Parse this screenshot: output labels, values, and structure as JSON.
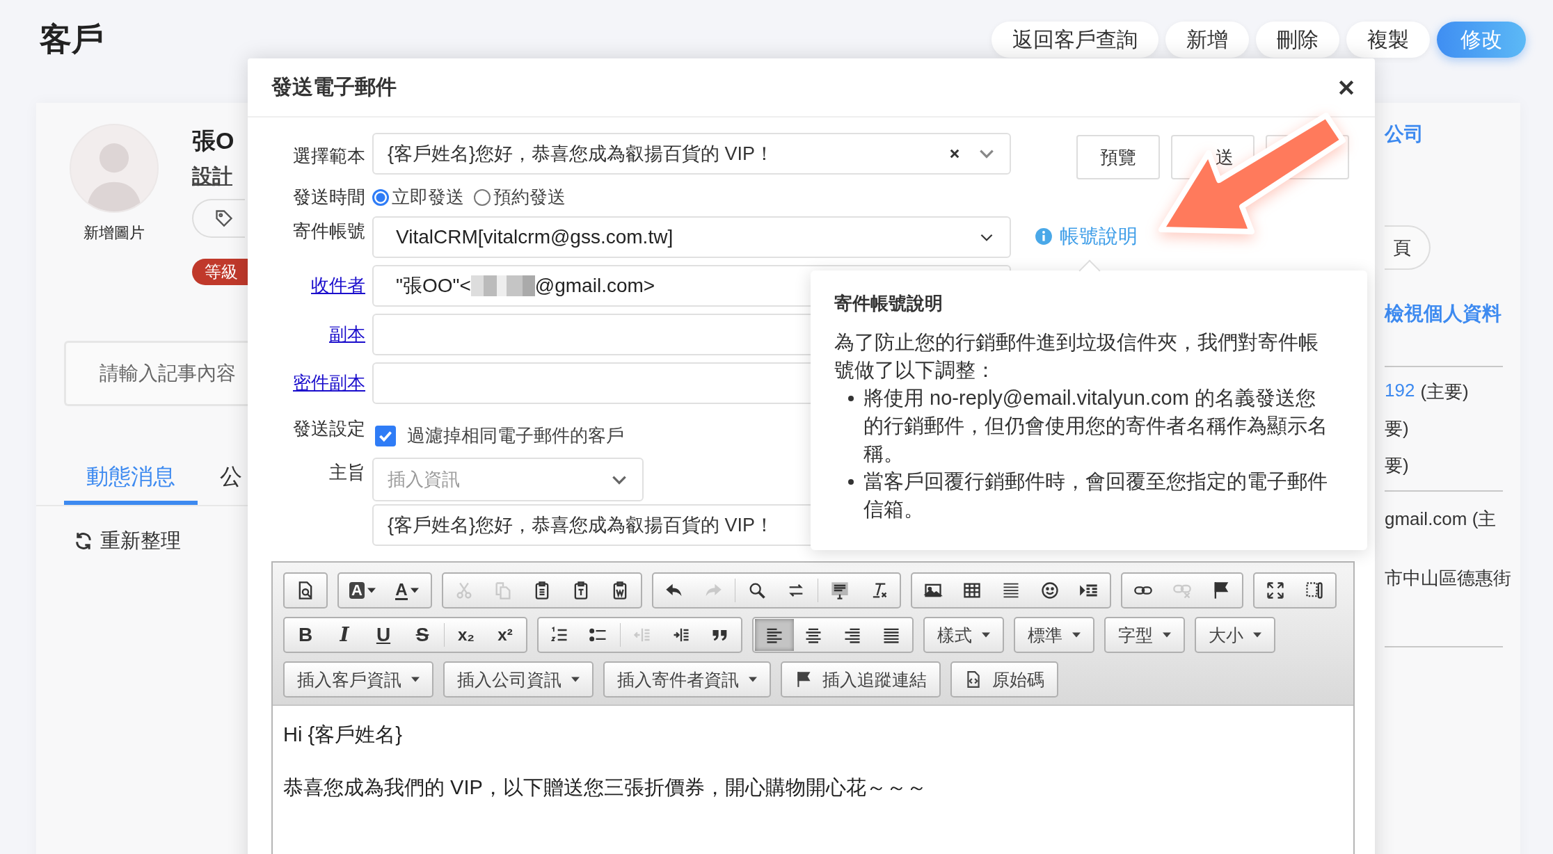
{
  "page": {
    "title": "客戶"
  },
  "top_buttons": [
    {
      "label": "返回客戶查詢",
      "kind": "default"
    },
    {
      "label": "新增",
      "kind": "default"
    },
    {
      "label": "刪除",
      "kind": "default"
    },
    {
      "label": "複製",
      "kind": "default"
    },
    {
      "label": "修改",
      "kind": "primary"
    }
  ],
  "customer": {
    "add_photo": "新增圖片",
    "name": "張O",
    "title": "設計",
    "badge": "等級",
    "note": {
      "placeholder": "請輸入記事內容"
    },
    "tabs": [
      {
        "label": "動態消息",
        "selected": true
      },
      {
        "label": "公",
        "selected": false
      }
    ],
    "refresh": "重新整理"
  },
  "side": {
    "company": "公司",
    "button": "頁",
    "profile_link": "檢視個人資料",
    "phone": {
      "number": "192",
      "note": "(主要)"
    },
    "lines": [
      "要)",
      "要)"
    ],
    "email": "gmail.com (主",
    "address": "市中山區德惠街"
  },
  "dialog": {
    "title": "發送電子郵件",
    "buttons": [
      "預覽",
      "送"
    ],
    "template": {
      "label": "選擇範本",
      "value": "{客戶姓名}您好，恭喜您成為叡揚百貨的 VIP！"
    },
    "send_time": {
      "label": "發送時間",
      "options": [
        {
          "label": "立即發送",
          "selected": true
        },
        {
          "label": "預約發送",
          "selected": false
        }
      ]
    },
    "account": {
      "label": "寄件帳號",
      "value": "VitalCRM[vitalcrm@gss.com.tw]",
      "help_link": "帳號說明"
    },
    "recipient": {
      "label": "收件者",
      "value_parts": [
        "\"張OO\"<",
        "@gmail.com>"
      ]
    },
    "cc": {
      "label": "副本"
    },
    "bcc": {
      "label": "密件副本"
    },
    "settings": {
      "label": "發送設定",
      "option": {
        "label": "過濾掉相同電子郵件的客戶",
        "checked": true
      }
    },
    "subject": {
      "label": "主旨",
      "insert": {
        "placeholder": "插入資訊"
      },
      "value": "{客戶姓名}您好，恭喜您成為叡揚百貨的 VIP！"
    },
    "tooltip": {
      "title": "寄件帳號說明",
      "intro": "為了防止您的行銷郵件進到垃圾信件夾，我們對寄件帳號做了以下調整：",
      "bullets": [
        "將使用 no-reply@email.vitalyun.com 的名義發送您的行銷郵件，但仍會使用您的寄件者名稱作為顯示名稱。",
        "當客戶回覆行銷郵件時，會回覆至您指定的電子郵件信箱。"
      ]
    },
    "editor": {
      "toolbar": {
        "rows": [
          {
            "groups": [
              {
                "items": [
                  {
                    "kind": "preview",
                    "disabled": false
                  }
                ]
              },
              {
                "items": [
                  {
                    "kind": "text-background",
                    "glyph": "A",
                    "disabled": false
                  },
                  {
                    "kind": "text-color",
                    "glyph": "A",
                    "disabled": false
                  }
                ]
              },
              {
                "items": [
                  {
                    "kind": "cut",
                    "disabled": true
                  },
                  {
                    "kind": "copy",
                    "disabled": true
                  },
                  {
                    "kind": "paste",
                    "disabled": false
                  },
                  {
                    "kind": "paste-text",
                    "disabled": false
                  },
                  {
                    "kind": "paste-word",
                    "disabled": false
                  }
                ]
              },
              {
                "items": [
                  {
                    "kind": "undo",
                    "disabled": false
                  },
                  {
                    "kind": "redo",
                    "disabled": true
                  },
                  {
                    "kind": "separator"
                  },
                  {
                    "kind": "find",
                    "disabled": false
                  },
                  {
                    "kind": "replace",
                    "disabled": false
                  },
                  {
                    "kind": "separator"
                  },
                  {
                    "kind": "template",
                    "disabled": false
                  },
                  {
                    "kind": "remove-format",
                    "disabled": false
                  }
                ]
              },
              {
                "items": [
                  {
                    "kind": "image",
                    "disabled": false
                  },
                  {
                    "kind": "table",
                    "disabled": false
                  },
                  {
                    "kind": "horizontal-rule",
                    "disabled": false
                  },
                  {
                    "kind": "smiley",
                    "disabled": false
                  },
                  {
                    "kind": "page-break",
                    "disabled": false
                  }
                ]
              },
              {
                "items": [
                  {
                    "kind": "link",
                    "disabled": false
                  },
                  {
                    "kind": "unlink",
                    "disabled": true
                  },
                  {
                    "kind": "anchor",
                    "disabled": false
                  }
                ]
              },
              {
                "items": [
                  {
                    "kind": "maximize",
                    "disabled": false
                  },
                  {
                    "kind": "show-blocks",
                    "disabled": false
                  }
                ]
              }
            ]
          },
          {
            "groups": [
              {
                "items": [
                  {
                    "kind": "bold",
                    "glyph": "B",
                    "disabled": false
                  },
                  {
                    "kind": "italic",
                    "glyph": "I",
                    "disabled": false
                  },
                  {
                    "kind": "underline",
                    "glyph": "U",
                    "disabled": false
                  },
                  {
                    "kind": "strikethrough",
                    "glyph": "S",
                    "disabled": false
                  },
                  {
                    "kind": "separator"
                  },
                  {
                    "kind": "subscript",
                    "glyph": "x₂",
                    "disabled": false
                  },
                  {
                    "kind": "superscript",
                    "glyph": "x²",
                    "disabled": false
                  }
                ]
              },
              {
                "items": [
                  {
                    "kind": "ordered-list",
                    "disabled": false
                  },
                  {
                    "kind": "bullet-list",
                    "disabled": false
                  },
                  {
                    "kind": "separator"
                  },
                  {
                    "kind": "outdent",
                    "disabled": true
                  },
                  {
                    "kind": "indent",
                    "disabled": false
                  },
                  {
                    "kind": "blockquote",
                    "disabled": false
                  }
                ]
              },
              {
                "items": [
                  {
                    "kind": "align-left",
                    "disabled": false,
                    "selected": true
                  },
                  {
                    "kind": "align-center",
                    "disabled": false,
                    "selected": false
                  },
                  {
                    "kind": "align-right",
                    "disabled": false,
                    "selected": false
                  },
                  {
                    "kind": "justify",
                    "disabled": false,
                    "selected": false
                  }
                ]
              },
              {
                "items": [
                  {
                    "kind": "dropdown",
                    "label": "樣式"
                  }
                ]
              },
              {
                "items": [
                  {
                    "kind": "dropdown",
                    "label": "標準"
                  }
                ]
              },
              {
                "items": [
                  {
                    "kind": "dropdown",
                    "label": "字型"
                  }
                ]
              },
              {
                "items": [
                  {
                    "kind": "dropdown",
                    "label": "大小"
                  }
                ]
              }
            ]
          },
          {
            "groups": [
              {
                "items": [
                  {
                    "kind": "dropdown",
                    "label": "插入客戶資訊"
                  }
                ]
              },
              {
                "items": [
                  {
                    "kind": "dropdown",
                    "label": "插入公司資訊"
                  }
                ]
              },
              {
                "items": [
                  {
                    "kind": "dropdown",
                    "label": "插入寄件者資訊"
                  }
                ]
              },
              {
                "items": [
                  {
                    "kind": "flag-command",
                    "label": "插入追蹤連結"
                  }
                ]
              },
              {
                "items": [
                  {
                    "kind": "source-command",
                    "label": "原始碼"
                  }
                ]
              }
            ]
          }
        ]
      },
      "body": [
        "Hi {客戶姓名}",
        "恭喜您成為我們的 VIP，以下贈送您三張折價券，開心購物開心花～～～"
      ]
    }
  }
}
